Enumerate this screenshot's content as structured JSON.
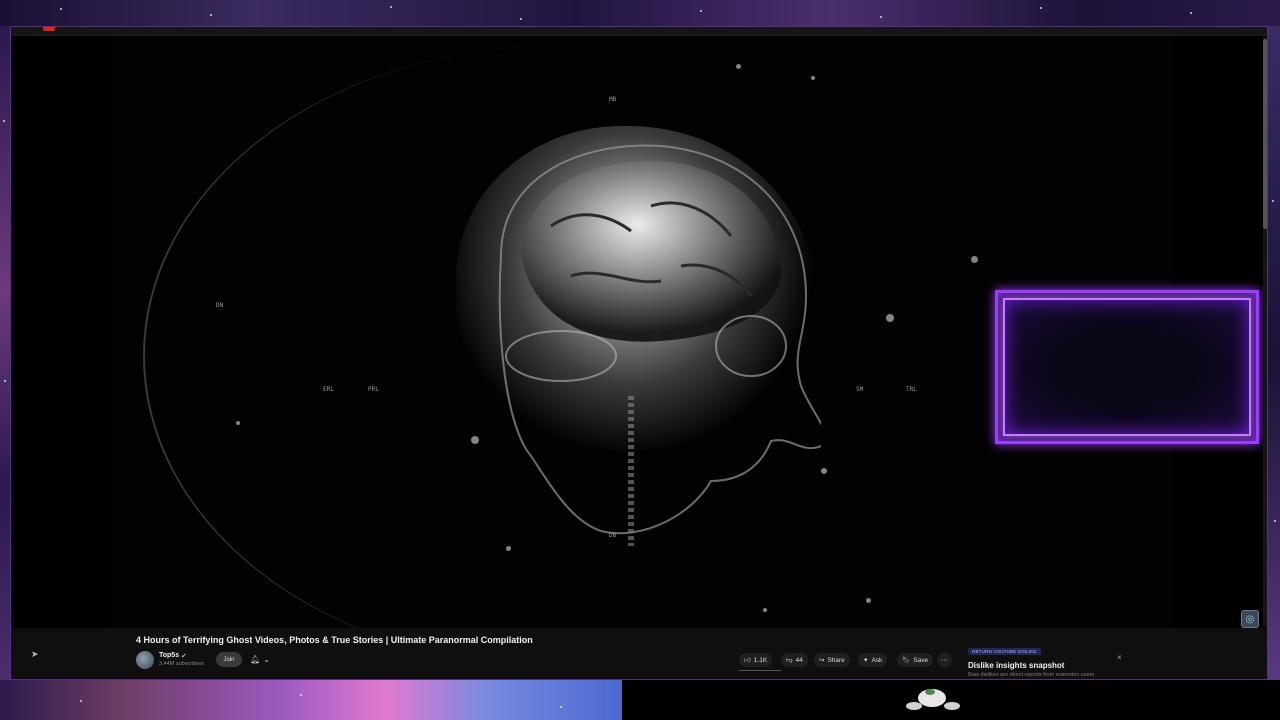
{
  "video": {
    "title": "4 Hours of Terrifying Ghost Videos, Photos & True Stories | Ultimate Paranormal Compilation",
    "hud_labels": [
      "MB",
      "DN",
      "ERL",
      "SM",
      "TRL",
      "PRL",
      "DB"
    ]
  },
  "channel": {
    "name": "Top5s",
    "verified_icon": "✔",
    "subscribers": "3.44M subscribers",
    "join_label": "Join"
  },
  "actions": {
    "like_count": "1.1K",
    "dislike_count": "44",
    "share_label": "Share",
    "ask_label": "Ask",
    "save_label": "Save",
    "more_icon": "⋯"
  },
  "dislike_panel": {
    "badge": "RETURN YOUTUBE DISLIKE",
    "title": "Dislike insights snapshot",
    "subtitle": "Raw dislikes are direct reports from extension users",
    "close_icon": "×"
  },
  "colors": {
    "neon_border": "#9b3cff",
    "window_border": "#5b2d8a",
    "page_bg": "#0f0f0f"
  }
}
